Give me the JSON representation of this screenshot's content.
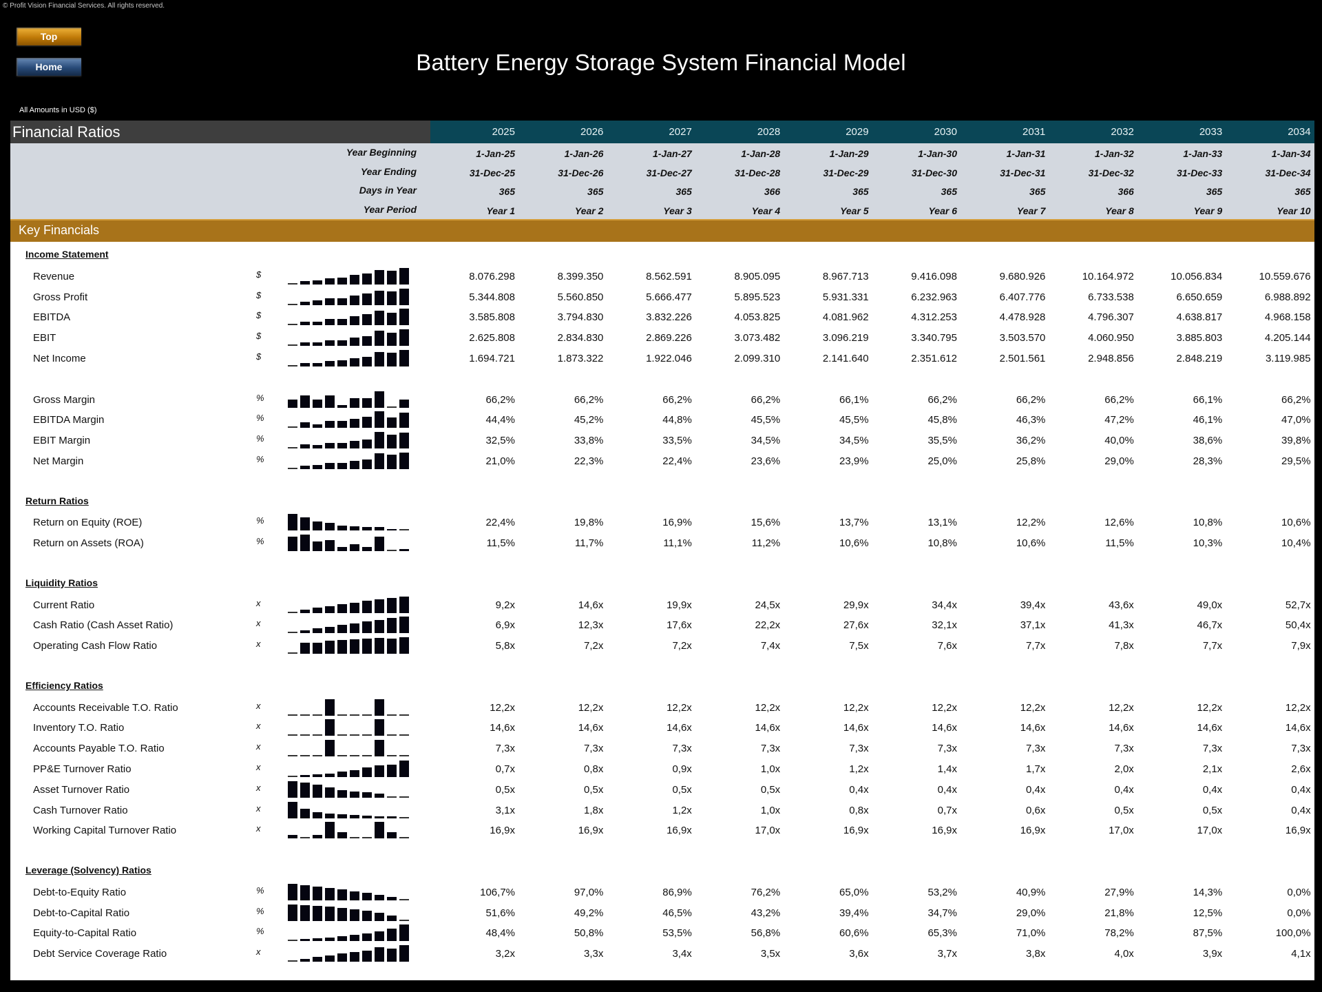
{
  "copyright": "© Profit Vision Financial Services. All rights reserved.",
  "nav": {
    "top_label": "Top",
    "home_label": "Home"
  },
  "title": "Battery Energy Storage System Financial Model",
  "currency_note": "All Amounts in  USD ($)",
  "sheet_title": "Financial Ratios",
  "years": [
    "2025",
    "2026",
    "2027",
    "2028",
    "2029",
    "2030",
    "2031",
    "2032",
    "2033",
    "2034"
  ],
  "meta": [
    {
      "label": "Year Beginning",
      "values": [
        "1-Jan-25",
        "1-Jan-26",
        "1-Jan-27",
        "1-Jan-28",
        "1-Jan-29",
        "1-Jan-30",
        "1-Jan-31",
        "1-Jan-32",
        "1-Jan-33",
        "1-Jan-34"
      ]
    },
    {
      "label": "Year Ending",
      "values": [
        "31-Dec-25",
        "31-Dec-26",
        "31-Dec-27",
        "31-Dec-28",
        "31-Dec-29",
        "31-Dec-30",
        "31-Dec-31",
        "31-Dec-32",
        "31-Dec-33",
        "31-Dec-34"
      ]
    },
    {
      "label": "Days in Year",
      "values": [
        "365",
        "365",
        "365",
        "366",
        "365",
        "365",
        "365",
        "366",
        "365",
        "365"
      ]
    },
    {
      "label": "Year Period",
      "values": [
        "Year 1",
        "Year 2",
        "Year 3",
        "Year 4",
        "Year 5",
        "Year 6",
        "Year 7",
        "Year 8",
        "Year 9",
        "Year 10"
      ]
    }
  ],
  "section_title": "Key Financials",
  "groups": [
    {
      "title": "Income Statement",
      "rows": [
        {
          "label": "Revenue",
          "unit": "$",
          "values": [
            "8.076.298",
            "8.399.350",
            "8.562.591",
            "8.905.095",
            "8.967.713",
            "9.416.098",
            "9.680.926",
            "10.164.972",
            "10.056.834",
            "10.559.676"
          ],
          "series": [
            8076298,
            8399350,
            8562591,
            8905095,
            8967713,
            9416098,
            9680926,
            10164972,
            10056834,
            10559676
          ]
        },
        {
          "label": "Gross Profit",
          "unit": "$",
          "values": [
            "5.344.808",
            "5.560.850",
            "5.666.477",
            "5.895.523",
            "5.931.331",
            "6.232.963",
            "6.407.776",
            "6.733.538",
            "6.650.659",
            "6.988.892"
          ],
          "series": [
            5344808,
            5560850,
            5666477,
            5895523,
            5931331,
            6232963,
            6407776,
            6733538,
            6650659,
            6988892
          ]
        },
        {
          "label": "EBITDA",
          "unit": "$",
          "values": [
            "3.585.808",
            "3.794.830",
            "3.832.226",
            "4.053.825",
            "4.081.962",
            "4.312.253",
            "4.478.928",
            "4.796.307",
            "4.638.817",
            "4.968.158"
          ],
          "series": [
            3585808,
            3794830,
            3832226,
            4053825,
            4081962,
            4312253,
            4478928,
            4796307,
            4638817,
            4968158
          ]
        },
        {
          "label": "EBIT",
          "unit": "$",
          "values": [
            "2.625.808",
            "2.834.830",
            "2.869.226",
            "3.073.482",
            "3.096.219",
            "3.340.795",
            "3.503.570",
            "4.060.950",
            "3.885.803",
            "4.205.144"
          ],
          "series": [
            2625808,
            2834830,
            2869226,
            3073482,
            3096219,
            3340795,
            3503570,
            4060950,
            3885803,
            4205144
          ]
        },
        {
          "label": "Net Income",
          "unit": "$",
          "values": [
            "1.694.721",
            "1.873.322",
            "1.922.046",
            "2.099.310",
            "2.141.640",
            "2.351.612",
            "2.501.561",
            "2.948.856",
            "2.848.219",
            "3.119.985"
          ],
          "series": [
            1694721,
            1873322,
            1922046,
            2099310,
            2141640,
            2351612,
            2501561,
            2948856,
            2848219,
            3119985
          ]
        },
        {
          "spacer": true
        },
        {
          "label": "Gross Margin",
          "unit": "%",
          "values": [
            "66,2%",
            "66,2%",
            "66,2%",
            "66,2%",
            "66,1%",
            "66,2%",
            "66,2%",
            "66,2%",
            "66,1%",
            "66,2%"
          ],
          "series": [
            66.18,
            66.21,
            66.18,
            66.21,
            66.14,
            66.19,
            66.19,
            66.24,
            66.13,
            66.18
          ]
        },
        {
          "label": "EBITDA Margin",
          "unit": "%",
          "values": [
            "44,4%",
            "45,2%",
            "44,8%",
            "45,5%",
            "45,5%",
            "45,8%",
            "46,3%",
            "47,2%",
            "46,1%",
            "47,0%"
          ],
          "series": [
            44.4,
            45.2,
            44.8,
            45.5,
            45.5,
            45.8,
            46.3,
            47.2,
            46.1,
            47.0
          ]
        },
        {
          "label": "EBIT Margin",
          "unit": "%",
          "values": [
            "32,5%",
            "33,8%",
            "33,5%",
            "34,5%",
            "34,5%",
            "35,5%",
            "36,2%",
            "40,0%",
            "38,6%",
            "39,8%"
          ],
          "series": [
            32.5,
            33.8,
            33.5,
            34.5,
            34.5,
            35.5,
            36.2,
            40.0,
            38.6,
            39.8
          ]
        },
        {
          "label": "Net Margin",
          "unit": "%",
          "values": [
            "21,0%",
            "22,3%",
            "22,4%",
            "23,6%",
            "23,9%",
            "25,0%",
            "25,8%",
            "29,0%",
            "28,3%",
            "29,5%"
          ],
          "series": [
            21.0,
            22.3,
            22.4,
            23.6,
            23.9,
            25.0,
            25.8,
            29.0,
            28.3,
            29.5
          ]
        }
      ]
    },
    {
      "title": "Return Ratios",
      "rows": [
        {
          "label": "Return on Equity (ROE)",
          "unit": "%",
          "values": [
            "22,4%",
            "19,8%",
            "16,9%",
            "15,6%",
            "13,7%",
            "13,1%",
            "12,2%",
            "12,6%",
            "10,8%",
            "10,6%"
          ],
          "series": [
            22.4,
            19.8,
            16.9,
            15.6,
            13.7,
            13.1,
            12.2,
            12.6,
            10.8,
            10.6
          ]
        },
        {
          "label": "Return on Assets (ROA)",
          "unit": "%",
          "values": [
            "11,5%",
            "11,7%",
            "11,1%",
            "11,2%",
            "10,6%",
            "10,8%",
            "10,6%",
            "11,5%",
            "10,3%",
            "10,4%"
          ],
          "series": [
            11.5,
            11.7,
            11.1,
            11.2,
            10.6,
            10.8,
            10.6,
            11.5,
            10.3,
            10.4
          ]
        }
      ]
    },
    {
      "title": "Liquidity Ratios",
      "rows": [
        {
          "label": "Current Ratio",
          "unit": "x",
          "values": [
            "9,2x",
            "14,6x",
            "19,9x",
            "24,5x",
            "29,9x",
            "34,4x",
            "39,4x",
            "43,6x",
            "49,0x",
            "52,7x"
          ],
          "series": [
            9.2,
            14.6,
            19.9,
            24.5,
            29.9,
            34.4,
            39.4,
            43.6,
            49.0,
            52.7
          ]
        },
        {
          "label": "Cash Ratio (Cash Asset Ratio)",
          "unit": "x",
          "values": [
            "6,9x",
            "12,3x",
            "17,6x",
            "22,2x",
            "27,6x",
            "32,1x",
            "37,1x",
            "41,3x",
            "46,7x",
            "50,4x"
          ],
          "series": [
            6.9,
            12.3,
            17.6,
            22.2,
            27.6,
            32.1,
            37.1,
            41.3,
            46.7,
            50.4
          ]
        },
        {
          "label": "Operating Cash Flow Ratio",
          "unit": "x",
          "values": [
            "5,8x",
            "7,2x",
            "7,2x",
            "7,4x",
            "7,5x",
            "7,6x",
            "7,7x",
            "7,8x",
            "7,7x",
            "7,9x"
          ],
          "series": [
            5.8,
            7.2,
            7.2,
            7.4,
            7.5,
            7.6,
            7.7,
            7.8,
            7.7,
            7.9
          ]
        }
      ]
    },
    {
      "title": "Efficiency Ratios",
      "rows": [
        {
          "label": "Accounts Receivable T.O. Ratio",
          "unit": "x",
          "values": [
            "12,2x",
            "12,2x",
            "12,2x",
            "12,2x",
            "12,2x",
            "12,2x",
            "12,2x",
            "12,2x",
            "12,2x",
            "12,2x"
          ],
          "series": [
            12.17,
            12.17,
            12.17,
            12.2,
            12.17,
            12.17,
            12.17,
            12.2,
            12.17,
            12.17
          ]
        },
        {
          "label": "Inventory T.O. Ratio",
          "unit": "x",
          "values": [
            "14,6x",
            "14,6x",
            "14,6x",
            "14,6x",
            "14,6x",
            "14,6x",
            "14,6x",
            "14,6x",
            "14,6x",
            "14,6x"
          ],
          "series": [
            14.6,
            14.6,
            14.6,
            14.64,
            14.6,
            14.6,
            14.6,
            14.64,
            14.6,
            14.6
          ]
        },
        {
          "label": "Accounts Payable T.O. Ratio",
          "unit": "x",
          "values": [
            "7,3x",
            "7,3x",
            "7,3x",
            "7,3x",
            "7,3x",
            "7,3x",
            "7,3x",
            "7,3x",
            "7,3x",
            "7,3x"
          ],
          "series": [
            7.3,
            7.3,
            7.3,
            7.32,
            7.3,
            7.3,
            7.3,
            7.32,
            7.3,
            7.3
          ]
        },
        {
          "label": "PP&E Turnover Ratio",
          "unit": "x",
          "values": [
            "0,7x",
            "0,8x",
            "0,9x",
            "1,0x",
            "1,2x",
            "1,4x",
            "1,7x",
            "2,0x",
            "2,1x",
            "2,6x"
          ],
          "series": [
            0.7,
            0.8,
            0.9,
            1.0,
            1.2,
            1.4,
            1.7,
            2.0,
            2.1,
            2.6
          ]
        },
        {
          "label": "Asset Turnover Ratio",
          "unit": "x",
          "values": [
            "0,5x",
            "0,5x",
            "0,5x",
            "0,5x",
            "0,4x",
            "0,4x",
            "0,4x",
            "0,4x",
            "0,4x",
            "0,4x"
          ],
          "series": [
            0.52,
            0.51,
            0.49,
            0.47,
            0.45,
            0.44,
            0.43,
            0.42,
            0.4,
            0.4
          ]
        },
        {
          "label": "Cash Turnover Ratio",
          "unit": "x",
          "values": [
            "3,1x",
            "1,8x",
            "1,2x",
            "1,0x",
            "0,8x",
            "0,7x",
            "0,6x",
            "0,5x",
            "0,5x",
            "0,4x"
          ],
          "series": [
            3.1,
            1.8,
            1.2,
            1.0,
            0.8,
            0.7,
            0.6,
            0.5,
            0.5,
            0.4
          ]
        },
        {
          "label": "Working Capital Turnover Ratio",
          "unit": "x",
          "values": [
            "16,9x",
            "16,9x",
            "16,9x",
            "17,0x",
            "16,9x",
            "16,9x",
            "16,9x",
            "17,0x",
            "17,0x",
            "16,9x"
          ],
          "series": [
            16.91,
            16.9,
            16.91,
            16.96,
            16.92,
            16.9,
            16.9,
            16.96,
            16.92,
            16.9
          ]
        }
      ]
    },
    {
      "title": "Leverage (Solvency) Ratios",
      "rows": [
        {
          "label": "Debt-to-Equity Ratio",
          "unit": "%",
          "values": [
            "106,7%",
            "97,0%",
            "86,9%",
            "76,2%",
            "65,0%",
            "53,2%",
            "40,9%",
            "27,9%",
            "14,3%",
            "0,0%"
          ],
          "series": [
            106.7,
            97.0,
            86.9,
            76.2,
            65.0,
            53.2,
            40.9,
            27.9,
            14.3,
            0.0
          ]
        },
        {
          "label": "Debt-to-Capital Ratio",
          "unit": "%",
          "values": [
            "51,6%",
            "49,2%",
            "46,5%",
            "43,2%",
            "39,4%",
            "34,7%",
            "29,0%",
            "21,8%",
            "12,5%",
            "0,0%"
          ],
          "series": [
            51.6,
            49.2,
            46.5,
            43.2,
            39.4,
            34.7,
            29.0,
            21.8,
            12.5,
            0.0
          ]
        },
        {
          "label": "Equity-to-Capital Ratio",
          "unit": "%",
          "values": [
            "48,4%",
            "50,8%",
            "53,5%",
            "56,8%",
            "60,6%",
            "65,3%",
            "71,0%",
            "78,2%",
            "87,5%",
            "100,0%"
          ],
          "series": [
            48.4,
            50.8,
            53.5,
            56.8,
            60.6,
            65.3,
            71.0,
            78.2,
            87.5,
            100.0
          ]
        },
        {
          "label": "Debt Service Coverage Ratio",
          "unit": "x",
          "values": [
            "3,2x",
            "3,3x",
            "3,4x",
            "3,5x",
            "3,6x",
            "3,7x",
            "3,8x",
            "4,0x",
            "3,9x",
            "4,1x"
          ],
          "series": [
            3.2,
            3.3,
            3.4,
            3.5,
            3.6,
            3.7,
            3.8,
            4.0,
            3.9,
            4.1
          ]
        }
      ]
    }
  ],
  "colors": {
    "header_dark": "#3e3e3e",
    "header_teal": "#0a4656",
    "meta_band": "#d3d8df",
    "section_band": "#a8731a"
  }
}
